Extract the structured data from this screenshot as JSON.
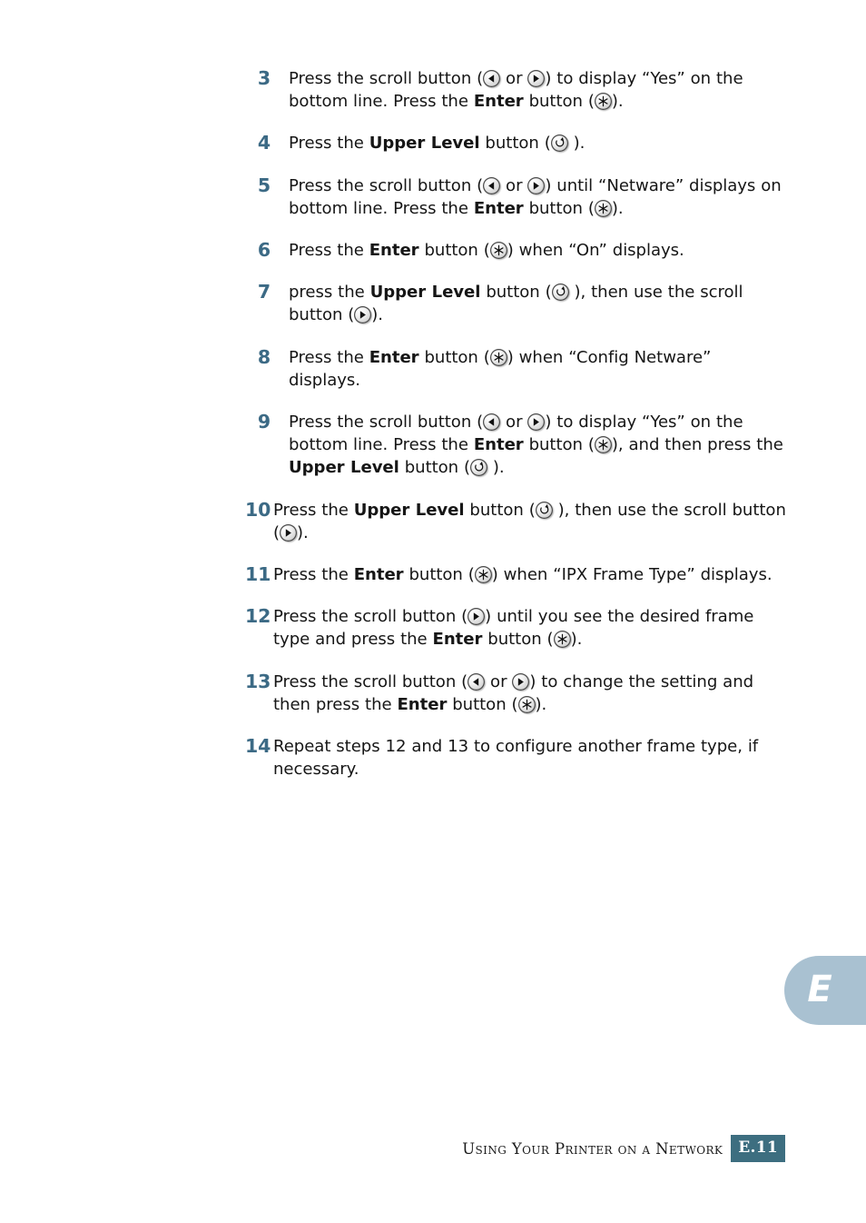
{
  "page": {
    "chapter_tab_letter": "E",
    "footer_title": "Using Your Printer on a Network",
    "footer_page": "E.11",
    "accent_step_number_color": "#3c6a85",
    "accent_tab_color": "#a9c1d1",
    "accent_footer_badge_color": "#3d6e80"
  },
  "icons": {
    "scroll_left": "scroll-left-button-icon",
    "scroll_right": "scroll-right-button-icon",
    "enter": "enter-button-icon",
    "upper_level": "upper-level-button-icon"
  },
  "steps": [
    {
      "number": "3",
      "parts": [
        {
          "t": "text",
          "v": "Press the scroll button ("
        },
        {
          "t": "icon",
          "v": "scroll_left"
        },
        {
          "t": "text",
          "v": " or "
        },
        {
          "t": "icon",
          "v": "scroll_right"
        },
        {
          "t": "text",
          "v": ") to display “Yes” on the bottom line. Press the "
        },
        {
          "t": "bold",
          "v": "Enter"
        },
        {
          "t": "text",
          "v": " button ("
        },
        {
          "t": "icon",
          "v": "enter"
        },
        {
          "t": "text",
          "v": ")."
        }
      ]
    },
    {
      "number": "4",
      "parts": [
        {
          "t": "text",
          "v": "Press the "
        },
        {
          "t": "bold",
          "v": "Upper Level"
        },
        {
          "t": "text",
          "v": " button ("
        },
        {
          "t": "icon",
          "v": "upper_level"
        },
        {
          "t": "text",
          "v": " )."
        }
      ]
    },
    {
      "number": "5",
      "parts": [
        {
          "t": "text",
          "v": "Press the scroll button ("
        },
        {
          "t": "icon",
          "v": "scroll_left"
        },
        {
          "t": "text",
          "v": " or "
        },
        {
          "t": "icon",
          "v": "scroll_right"
        },
        {
          "t": "text",
          "v": ") until “Netware” displays on bottom line. Press the "
        },
        {
          "t": "bold",
          "v": "Enter"
        },
        {
          "t": "text",
          "v": " button ("
        },
        {
          "t": "icon",
          "v": "enter"
        },
        {
          "t": "text",
          "v": ")."
        }
      ]
    },
    {
      "number": "6",
      "parts": [
        {
          "t": "text",
          "v": "Press the "
        },
        {
          "t": "bold",
          "v": "Enter"
        },
        {
          "t": "text",
          "v": " button ("
        },
        {
          "t": "icon",
          "v": "enter"
        },
        {
          "t": "text",
          "v": ") when “On” displays."
        }
      ]
    },
    {
      "number": "7",
      "parts": [
        {
          "t": "text",
          "v": "press the "
        },
        {
          "t": "bold",
          "v": "Upper Level"
        },
        {
          "t": "text",
          "v": " button ("
        },
        {
          "t": "icon",
          "v": "upper_level"
        },
        {
          "t": "text",
          "v": " ), then use the scroll button ("
        },
        {
          "t": "icon",
          "v": "scroll_right"
        },
        {
          "t": "text",
          "v": ")."
        }
      ]
    },
    {
      "number": "8",
      "parts": [
        {
          "t": "text",
          "v": "Press the "
        },
        {
          "t": "bold",
          "v": "Enter"
        },
        {
          "t": "text",
          "v": " button ("
        },
        {
          "t": "icon",
          "v": "enter"
        },
        {
          "t": "text",
          "v": ") when “Config Netware” displays."
        }
      ]
    },
    {
      "number": "9",
      "parts": [
        {
          "t": "text",
          "v": "Press the scroll button ("
        },
        {
          "t": "icon",
          "v": "scroll_left"
        },
        {
          "t": "text",
          "v": " or "
        },
        {
          "t": "icon",
          "v": "scroll_right"
        },
        {
          "t": "text",
          "v": ") to display “Yes” on the bottom line. Press the "
        },
        {
          "t": "bold",
          "v": "Enter"
        },
        {
          "t": "text",
          "v": " button ("
        },
        {
          "t": "icon",
          "v": "enter"
        },
        {
          "t": "text",
          "v": "), and then press the "
        },
        {
          "t": "bold",
          "v": "Upper Level"
        },
        {
          "t": "text",
          "v": " button ("
        },
        {
          "t": "icon",
          "v": "upper_level"
        },
        {
          "t": "text",
          "v": " )."
        }
      ]
    },
    {
      "number": "10",
      "parts": [
        {
          "t": "text",
          "v": "Press the "
        },
        {
          "t": "bold",
          "v": "Upper Level"
        },
        {
          "t": "text",
          "v": " button ("
        },
        {
          "t": "icon",
          "v": "upper_level"
        },
        {
          "t": "text",
          "v": " ), then use the scroll button ("
        },
        {
          "t": "icon",
          "v": "scroll_right"
        },
        {
          "t": "text",
          "v": ")."
        }
      ]
    },
    {
      "number": "11",
      "parts": [
        {
          "t": "text",
          "v": "Press the "
        },
        {
          "t": "bold",
          "v": "Enter"
        },
        {
          "t": "text",
          "v": " button ("
        },
        {
          "t": "icon",
          "v": "enter"
        },
        {
          "t": "text",
          "v": ") when “IPX Frame Type” displays."
        }
      ]
    },
    {
      "number": "12",
      "parts": [
        {
          "t": "text",
          "v": "Press the scroll button ("
        },
        {
          "t": "icon",
          "v": "scroll_right"
        },
        {
          "t": "text",
          "v": ") until you see the desired frame type and press the "
        },
        {
          "t": "bold",
          "v": "Enter"
        },
        {
          "t": "text",
          "v": " button ("
        },
        {
          "t": "icon",
          "v": "enter"
        },
        {
          "t": "text",
          "v": ")."
        }
      ]
    },
    {
      "number": "13",
      "parts": [
        {
          "t": "text",
          "v": "Press the scroll button ("
        },
        {
          "t": "icon",
          "v": "scroll_left"
        },
        {
          "t": "text",
          "v": " or "
        },
        {
          "t": "icon",
          "v": "scroll_right"
        },
        {
          "t": "text",
          "v": ") to change the setting and then press the "
        },
        {
          "t": "bold",
          "v": "Enter"
        },
        {
          "t": "text",
          "v": " button ("
        },
        {
          "t": "icon",
          "v": "enter"
        },
        {
          "t": "text",
          "v": ")."
        }
      ]
    },
    {
      "number": "14",
      "parts": [
        {
          "t": "text",
          "v": "Repeat steps 12 and 13 to configure another frame type, if necessary."
        }
      ]
    }
  ]
}
